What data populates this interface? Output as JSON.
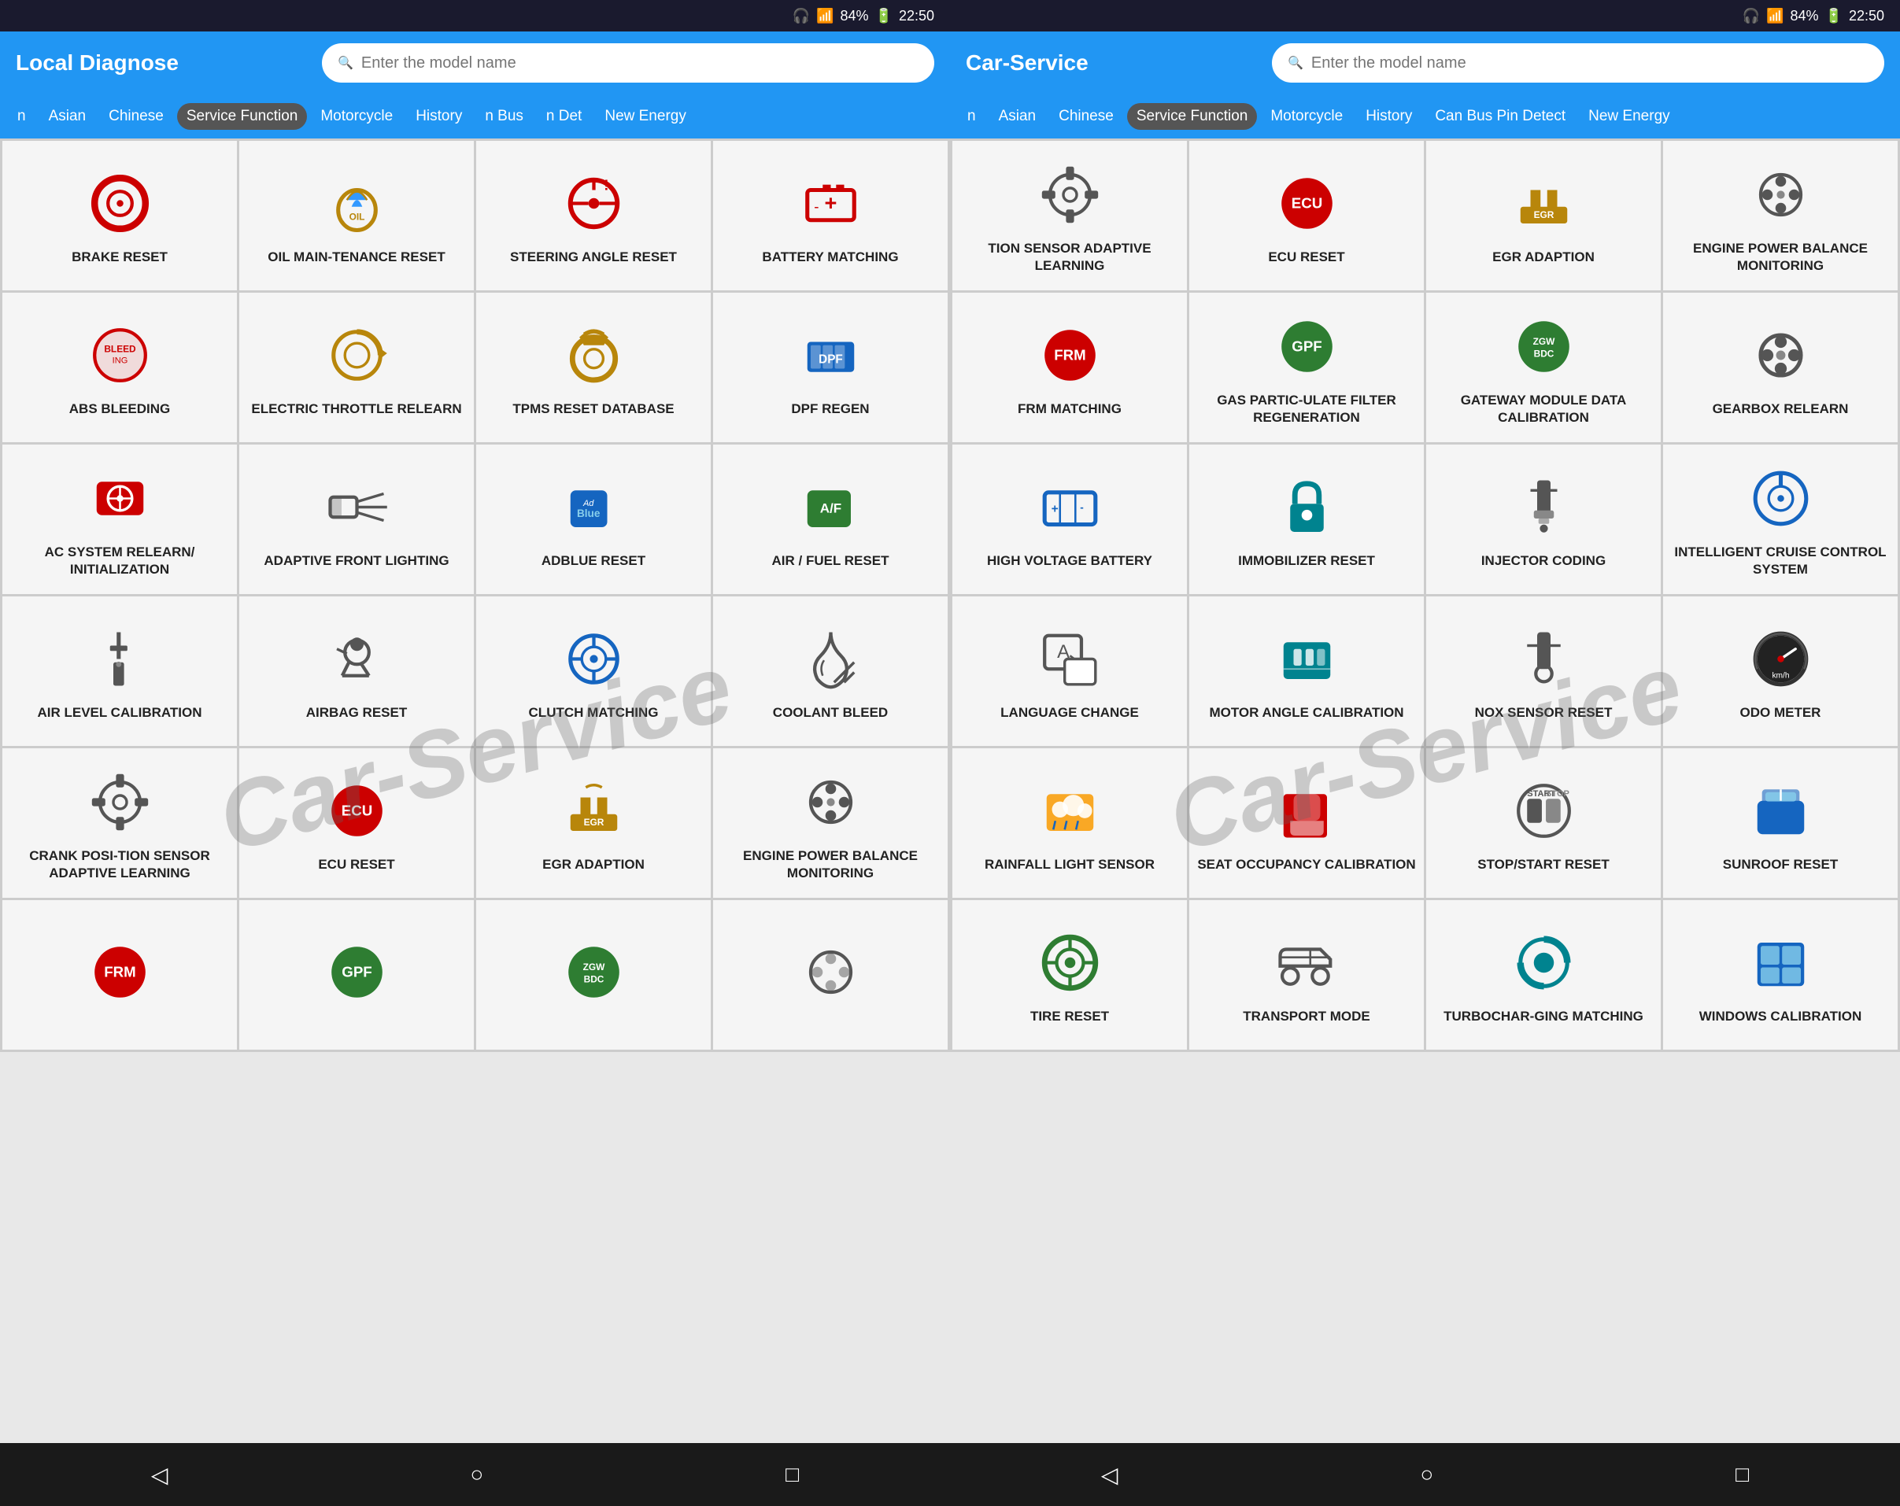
{
  "panels": [
    {
      "id": "left",
      "statusBar": {
        "bluetooth": "BT",
        "signal": "📶",
        "battery": "84%",
        "time": "22:50"
      },
      "header": {
        "title": "Local Diagnose",
        "searchPlaceholder": "Enter the model name"
      },
      "navTabs": [
        {
          "label": "n",
          "active": false
        },
        {
          "label": "Asian",
          "active": false
        },
        {
          "label": "Chinese",
          "active": false
        },
        {
          "label": "Service Function",
          "active": true
        },
        {
          "label": "Motorcycle",
          "active": false
        },
        {
          "label": "History",
          "active": false
        },
        {
          "label": "n Bus",
          "active": false
        },
        {
          "label": "n Det",
          "active": false
        },
        {
          "label": "New Energy",
          "active": false
        }
      ],
      "items": [
        {
          "label": "BRAKE RESET",
          "icon": "brake",
          "color": "red"
        },
        {
          "label": "OIL MAIN-TENANCE RESET",
          "icon": "oil",
          "color": "gold"
        },
        {
          "label": "STEERING ANGLE RESET",
          "icon": "steering",
          "color": "red"
        },
        {
          "label": "BATTERY MATCHING",
          "icon": "battery",
          "color": "red"
        },
        {
          "label": "ABS BLEEDING",
          "icon": "abs",
          "color": "red"
        },
        {
          "label": "ELECTRIC THROTTLE RELEARN",
          "icon": "throttle",
          "color": "gold"
        },
        {
          "label": "TPMS RESET DATABASE",
          "icon": "tpms",
          "color": "gold"
        },
        {
          "label": "DPF REGEN",
          "icon": "dpf",
          "color": "blue"
        },
        {
          "label": "AC SYSTEM RELEARN/ INITIALIZATION",
          "icon": "ac",
          "color": "red"
        },
        {
          "label": "ADAPTIVE FRONT LIGHTING",
          "icon": "afl",
          "color": "gray"
        },
        {
          "label": "ADBLUE RESET",
          "icon": "adblue",
          "color": "blue"
        },
        {
          "label": "AIR / FUEL RESET",
          "icon": "airfuel",
          "color": "green"
        },
        {
          "label": "AIR LEVEL CALIBRATION",
          "icon": "airlevel",
          "color": "gray"
        },
        {
          "label": "AIRBAG RESET",
          "icon": "airbag",
          "color": "gray"
        },
        {
          "label": "CLUTCH MATCHING",
          "icon": "clutch",
          "color": "blue"
        },
        {
          "label": "COOLANT BLEED",
          "icon": "coolant",
          "color": "gray"
        },
        {
          "label": "CRANK POSI-TION SENSOR ADAPTIVE LEARNING",
          "icon": "crank",
          "color": "gray"
        },
        {
          "label": "ECU RESET",
          "icon": "ecu",
          "color": "red"
        },
        {
          "label": "EGR ADAPTION",
          "icon": "egr",
          "color": "gold"
        },
        {
          "label": "ENGINE POWER BALANCE MONITORING",
          "icon": "epbm",
          "color": "gray"
        },
        {
          "label": "",
          "icon": "frm",
          "color": "red"
        },
        {
          "label": "",
          "icon": "gpf",
          "color": "green"
        },
        {
          "label": "",
          "icon": "zgwbdc",
          "color": "green"
        },
        {
          "label": "",
          "icon": "gearbox2",
          "color": "gray"
        }
      ]
    },
    {
      "id": "right",
      "statusBar": {
        "bluetooth": "BT",
        "signal": "📶",
        "battery": "84%",
        "time": "22:50"
      },
      "header": {
        "title": "Car-Service",
        "searchPlaceholder": "Enter the model name"
      },
      "navTabs": [
        {
          "label": "n",
          "active": false
        },
        {
          "label": "Asian",
          "active": false
        },
        {
          "label": "Chinese",
          "active": false
        },
        {
          "label": "Service Function",
          "active": true
        },
        {
          "label": "Motorcycle",
          "active": false
        },
        {
          "label": "History",
          "active": false
        },
        {
          "label": "Can Bus Pin Detect",
          "active": false
        },
        {
          "label": "New Energy",
          "active": false
        }
      ],
      "items": [
        {
          "label": "TION SENSOR ADAPTIVE LEARNING",
          "icon": "crank2",
          "color": "gray"
        },
        {
          "label": "ECU RESET",
          "icon": "ecu",
          "color": "red"
        },
        {
          "label": "EGR ADAPTION",
          "icon": "egr",
          "color": "gold"
        },
        {
          "label": "ENGINE POWER BALANCE MONITORING",
          "icon": "epbm",
          "color": "gray"
        },
        {
          "label": "FRM MATCHING",
          "icon": "frm",
          "color": "red"
        },
        {
          "label": "GAS PARTIC-ULATE FILTER REGENERATION",
          "icon": "gpf",
          "color": "green"
        },
        {
          "label": "GATEWAY MODULE DATA CALIBRATION",
          "icon": "zgwbdc",
          "color": "green"
        },
        {
          "label": "GEARBOX RELEARN",
          "icon": "gearbox",
          "color": "gray"
        },
        {
          "label": "HIGH VOLTAGE BATTERY",
          "icon": "hvbat",
          "color": "blue"
        },
        {
          "label": "IMMOBILIZER RESET",
          "icon": "immob",
          "color": "teal"
        },
        {
          "label": "INJECTOR CODING",
          "icon": "injector",
          "color": "gray"
        },
        {
          "label": "INTELLIGENT CRUISE CONTROL SYSTEM",
          "icon": "icc",
          "color": "blue"
        },
        {
          "label": "LANGUAGE CHANGE",
          "icon": "language",
          "color": "gray"
        },
        {
          "label": "MOTOR ANGLE CALIBRATION",
          "icon": "motorangle",
          "color": "teal"
        },
        {
          "label": "NOX SENSOR RESET",
          "icon": "nox",
          "color": "gray"
        },
        {
          "label": "ODO METER",
          "icon": "odometer",
          "color": "gray"
        },
        {
          "label": "RAINFALL LIGHT SENSOR",
          "icon": "rainfall",
          "color": "gold"
        },
        {
          "label": "SEAT OCCUPANCY CALIBRATION",
          "icon": "seat",
          "color": "red"
        },
        {
          "label": "STOP/START RESET",
          "icon": "stopstart",
          "color": "gray"
        },
        {
          "label": "SUNROOF RESET",
          "icon": "sunroof",
          "color": "blue"
        },
        {
          "label": "TIRE RESET",
          "icon": "tire",
          "color": "green"
        },
        {
          "label": "TRANSPORT MODE",
          "icon": "transport",
          "color": "gray"
        },
        {
          "label": "TURBOCHAR-GING MATCHING",
          "icon": "turbo",
          "color": "teal"
        },
        {
          "label": "WINDOWS CALIBRATION",
          "icon": "windows",
          "color": "blue"
        }
      ]
    }
  ],
  "watermark": "Car-Service"
}
